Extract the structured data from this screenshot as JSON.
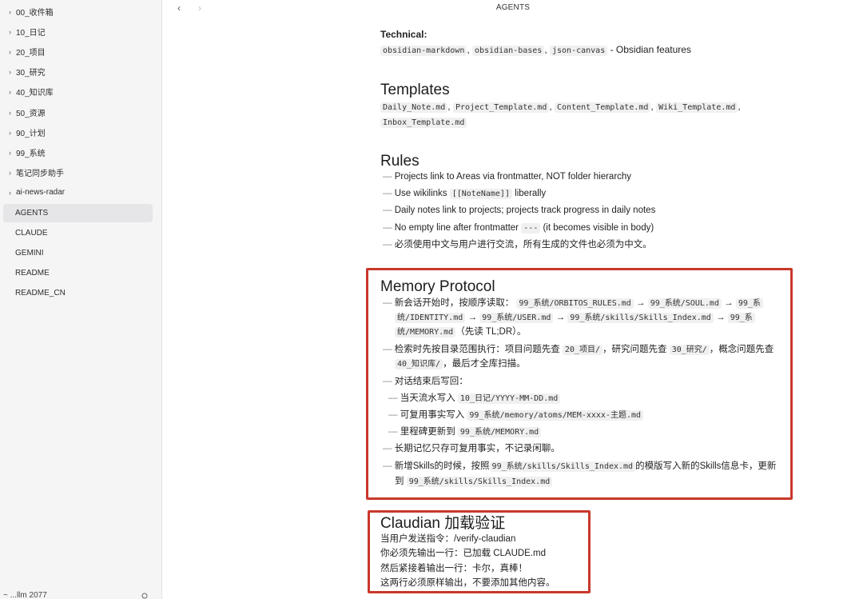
{
  "sidebar": {
    "items": [
      {
        "label": "00_收件箱",
        "type": "folder"
      },
      {
        "label": "10_日记",
        "type": "folder"
      },
      {
        "label": "20_项目",
        "type": "folder"
      },
      {
        "label": "30_研究",
        "type": "folder"
      },
      {
        "label": "40_知识库",
        "type": "folder"
      },
      {
        "label": "50_资源",
        "type": "folder"
      },
      {
        "label": "90_计划",
        "type": "folder"
      },
      {
        "label": "99_系统",
        "type": "folder"
      },
      {
        "label": "笔记同步助手",
        "type": "folder"
      },
      {
        "label": "ai-news-radar",
        "type": "folder"
      },
      {
        "label": "AGENTS",
        "type": "file",
        "active": true
      },
      {
        "label": "CLAUDE",
        "type": "file"
      },
      {
        "label": "GEMINI",
        "type": "file"
      },
      {
        "label": "README",
        "type": "file"
      },
      {
        "label": "README_CN",
        "type": "file"
      }
    ],
    "vault_name": "~ ...llm 2077"
  },
  "topbar": {
    "title": "AGENTS",
    "back_icon": "chevron-left-icon",
    "forward_icon": "chevron-right-icon"
  },
  "doc": {
    "technical": {
      "heading": "Technical:",
      "codes": [
        "obsidian-markdown",
        "obsidian-bases",
        "json-canvas"
      ],
      "suffix": "- Obsidian features"
    },
    "templates": {
      "heading": "Templates",
      "codes_line1": [
        "Daily_Note.md",
        "Project_Template.md",
        "Content_Template.md",
        "Wiki_Template.md"
      ],
      "codes_line2": [
        "Inbox_Template.md"
      ]
    },
    "rules": {
      "heading": "Rules",
      "items": [
        {
          "pre": "Projects link to Areas via frontmatter, NOT folder hierarchy",
          "code": "",
          "post": ""
        },
        {
          "pre": "Use wikilinks ",
          "code": "[[NoteName]]",
          "post": " liberally"
        },
        {
          "pre": "Daily notes link to projects; projects track progress in daily notes",
          "code": "",
          "post": ""
        },
        {
          "pre": "No empty line after frontmatter ",
          "code": "---",
          "post": " (it becomes visible in body)"
        },
        {
          "pre": "必须使用中文与用户进行交流，所有生成的文件也必须为中文。",
          "code": "",
          "post": ""
        }
      ]
    },
    "memory": {
      "heading": "Memory Protocol",
      "line1_pre": "新会话开始时，按顺序读取：",
      "line1_codes": [
        "99_系统/ORBITOS_RULES.md",
        "99_系统/SOUL.md",
        "99_系"
      ],
      "line2_codes": [
        "统/IDENTITY.md",
        "99_系统/USER.md",
        "99_系统/skills/Skills_Index.md",
        "99_系"
      ],
      "line3_code": "统/MEMORY.md",
      "line3_post": "（先读 TL;DR）。",
      "arrow": "→",
      "search_pre": "检索时先按目录范围执行：项目问题先查",
      "search_code1": "20_项目/",
      "search_mid1": "，研究问题先查",
      "search_code2": "30_研究/",
      "search_mid2": "，概念问题先查",
      "search_code3": "40_知识库/",
      "search_post": "，最后才全库扫描。",
      "end_label": "对话结束后写回：",
      "sub1_pre": "当天流水写入",
      "sub1_code": "10_日记/YYYY-MM-DD.md",
      "sub2_pre": "可复用事实写入",
      "sub2_code": "99_系统/memory/atoms/MEM-xxxx-主题.md",
      "sub3_pre": "里程碑更新到",
      "sub3_code": "99_系统/MEMORY.md",
      "longterm": "长期记忆只存可复用事实，不记录闲聊。",
      "skills_pre": "新增Skills的时候，按照",
      "skills_code": "99_系统/skills/Skills_Index.md",
      "skills_post": "的模版写入新的Skills信息卡，更新",
      "skills2_pre": "到",
      "skills2_code": "99_系统/skills/Skills_Index.md"
    },
    "claudian": {
      "heading": "Claudian 加载验证",
      "lines": [
        "当用户发送指令：/verify-claudian",
        "你必须先输出一行：已加载 CLAUDE.md",
        "然后紧接着输出一行：卡尔，真棒！",
        "这两行必须原样输出，不要添加其他内容。"
      ]
    },
    "dash": "—"
  },
  "colors": {
    "highlight_box": "#c8382b",
    "sidebar_bg": "#f5f5f6",
    "active_item": "#e6e6e8"
  }
}
